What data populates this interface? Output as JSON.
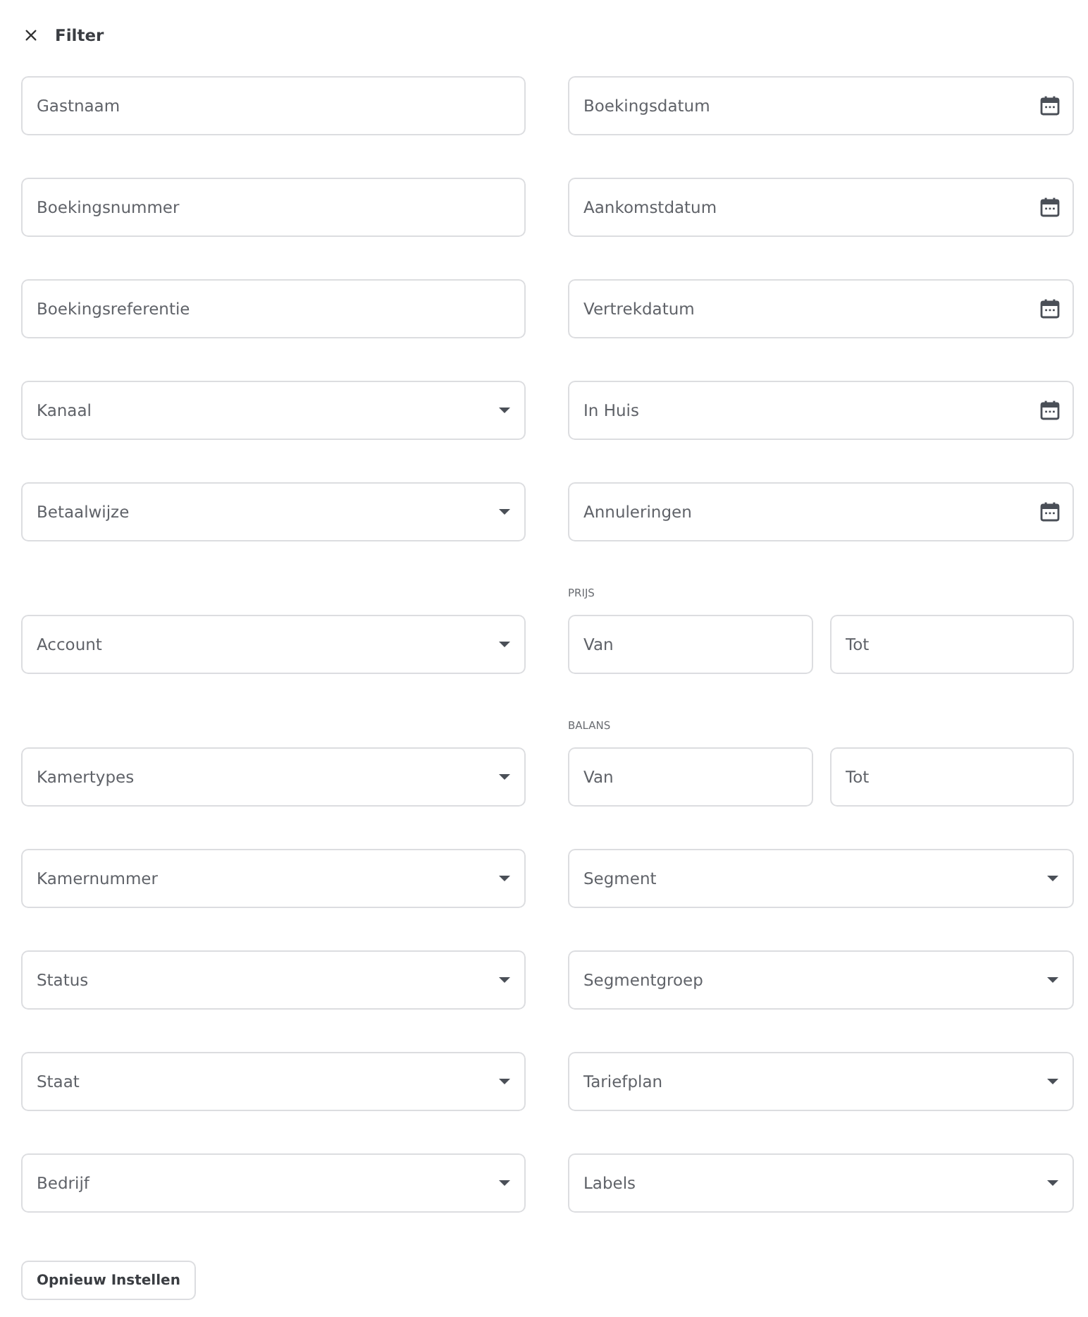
{
  "header": {
    "title": "Filter"
  },
  "rows": [
    {
      "left": {
        "kind": "text",
        "placeholder": "Gastnaam"
      },
      "right": {
        "kind": "date",
        "placeholder": "Boekingsdatum"
      }
    },
    {
      "left": {
        "kind": "text",
        "placeholder": "Boekingsnummer"
      },
      "right": {
        "kind": "date",
        "placeholder": "Aankomstdatum"
      }
    },
    {
      "left": {
        "kind": "text",
        "placeholder": "Boekingsreferentie"
      },
      "right": {
        "kind": "date",
        "placeholder": "Vertrekdatum"
      }
    },
    {
      "left": {
        "kind": "select",
        "placeholder": "Kanaal"
      },
      "right": {
        "kind": "date",
        "placeholder": "In Huis"
      }
    },
    {
      "left": {
        "kind": "select",
        "placeholder": "Betaalwijze"
      },
      "right": {
        "kind": "date",
        "placeholder": "Annuleringen"
      }
    },
    {
      "left": {
        "kind": "select",
        "placeholder": "Account"
      },
      "right": {
        "kind": "range",
        "label": "PRIJS",
        "from": {
          "placeholder": "Van"
        },
        "to": {
          "placeholder": "Tot"
        }
      }
    },
    {
      "left": {
        "kind": "select",
        "placeholder": "Kamertypes"
      },
      "right": {
        "kind": "range",
        "label": "BALANS",
        "from": {
          "placeholder": "Van"
        },
        "to": {
          "placeholder": "Tot"
        }
      }
    },
    {
      "left": {
        "kind": "select",
        "placeholder": "Kamernummer"
      },
      "right": {
        "kind": "select",
        "placeholder": "Segment"
      }
    },
    {
      "left": {
        "kind": "select",
        "placeholder": "Status"
      },
      "right": {
        "kind": "select",
        "placeholder": "Segmentgroep"
      }
    },
    {
      "left": {
        "kind": "select",
        "placeholder": "Staat"
      },
      "right": {
        "kind": "select",
        "placeholder": "Tariefplan"
      }
    },
    {
      "left": {
        "kind": "select",
        "placeholder": "Bedrijf"
      },
      "right": {
        "kind": "select",
        "placeholder": "Labels"
      }
    }
  ],
  "reset_button": {
    "label": "Opnieuw Instellen"
  }
}
